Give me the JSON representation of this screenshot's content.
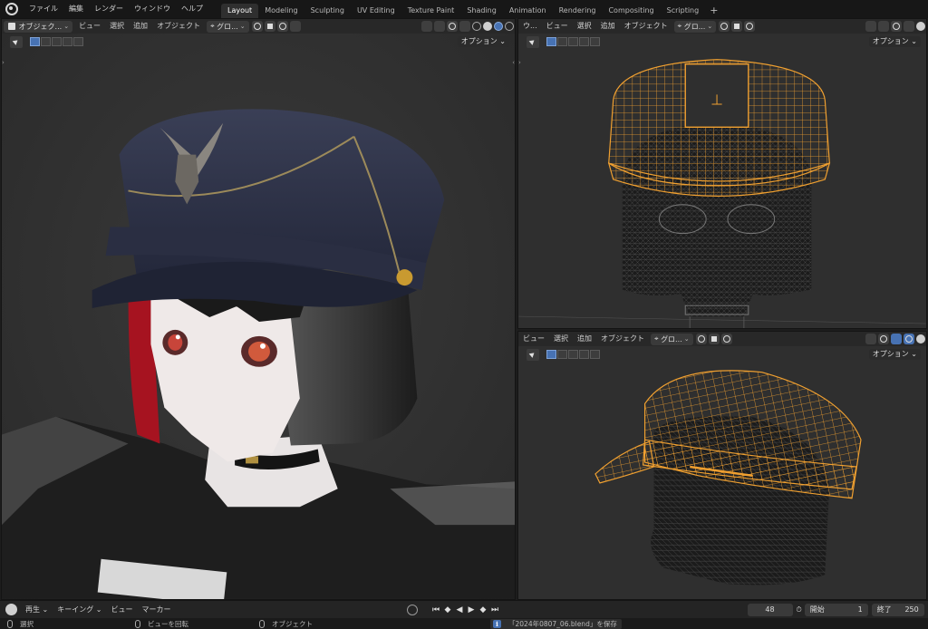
{
  "menu": [
    "ファイル",
    "編集",
    "レンダー",
    "ウィンドウ",
    "ヘルプ"
  ],
  "workspaces": [
    "Layout",
    "Modeling",
    "Sculpting",
    "UV Editing",
    "Texture Paint",
    "Shading",
    "Animation",
    "Rendering",
    "Compositing",
    "Scripting"
  ],
  "active_workspace": "Layout",
  "main_view": {
    "mode": "オブジェク...",
    "view": "ビュー",
    "select": "選択",
    "add": "追加",
    "object": "オブジェクト",
    "orientation": "グロ...",
    "options": "オプション"
  },
  "front_view": {
    "mode": "ウ...",
    "view": "ビュー",
    "select": "選択",
    "add": "追加",
    "object": "オブジェクト",
    "orientation": "グロ...",
    "options": "オプション"
  },
  "persp_view": {
    "view": "ビュー",
    "select": "選択",
    "add": "追加",
    "object": "オブジェクト",
    "orientation": "グロ...",
    "options": "オプション"
  },
  "timeline": {
    "playback": "再生",
    "keying": "キーイング",
    "view": "ビュー",
    "marker": "マーカー",
    "current_frame": "48",
    "start_label": "開始",
    "start": "1",
    "end_label": "終了",
    "end": "250"
  },
  "status": {
    "select": "選択",
    "rotate": "ビューを回転",
    "object": "オブジェクト",
    "message": "「2024年0807_06.blend」を保存"
  },
  "colors": {
    "wire_selected": "#f0a030",
    "accent": "#4772b3",
    "cap_navy": "#2f3347"
  },
  "icons": [
    "blender-logo-icon",
    "select-box-icon",
    "shading-solid-icon",
    "play-icon",
    "stopwatch-icon",
    "info-icon",
    "mouse-icon"
  ]
}
